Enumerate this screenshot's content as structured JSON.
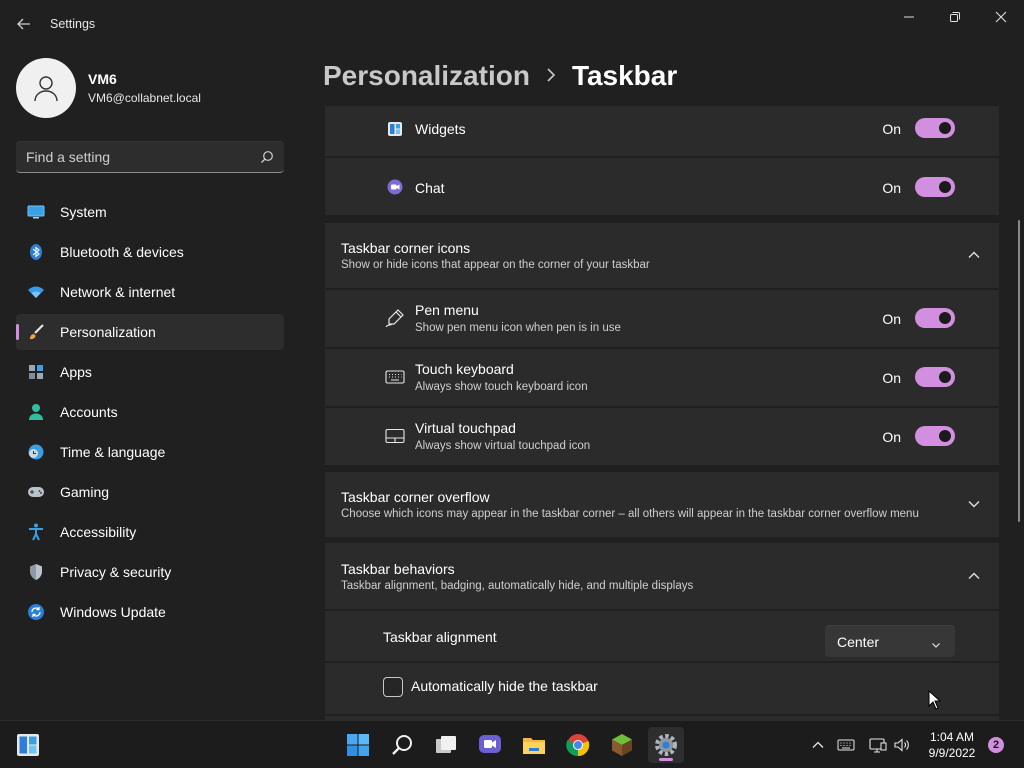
{
  "window": {
    "title": "Settings"
  },
  "user": {
    "name": "VM6",
    "email": "VM6@collabnet.local"
  },
  "search": {
    "placeholder": "Find a setting"
  },
  "nav": {
    "items": [
      {
        "label": "System",
        "icon": "monitor-icon"
      },
      {
        "label": "Bluetooth & devices",
        "icon": "bluetooth-icon"
      },
      {
        "label": "Network & internet",
        "icon": "wifi-icon"
      },
      {
        "label": "Personalization",
        "icon": "brush-icon",
        "active": true
      },
      {
        "label": "Apps",
        "icon": "apps-icon"
      },
      {
        "label": "Accounts",
        "icon": "person-icon"
      },
      {
        "label": "Time & language",
        "icon": "globe-clock-icon"
      },
      {
        "label": "Gaming",
        "icon": "gamepad-icon"
      },
      {
        "label": "Accessibility",
        "icon": "accessibility-icon"
      },
      {
        "label": "Privacy & security",
        "icon": "shield-icon"
      },
      {
        "label": "Windows Update",
        "icon": "update-icon"
      }
    ]
  },
  "breadcrumb": {
    "parent": "Personalization",
    "current": "Taskbar"
  },
  "main": {
    "widgets": {
      "label": "Widgets",
      "state": "On"
    },
    "chat": {
      "label": "Chat",
      "state": "On"
    },
    "corner_icons": {
      "title": "Taskbar corner icons",
      "desc": "Show or hide icons that appear on the corner of your taskbar"
    },
    "pen_menu": {
      "label": "Pen menu",
      "desc": "Show pen menu icon when pen is in use",
      "state": "On"
    },
    "touch_keyboard": {
      "label": "Touch keyboard",
      "desc": "Always show touch keyboard icon",
      "state": "On"
    },
    "virtual_touchpad": {
      "label": "Virtual touchpad",
      "desc": "Always show virtual touchpad icon",
      "state": "On"
    },
    "corner_overflow": {
      "title": "Taskbar corner overflow",
      "desc": "Choose which icons may appear in the taskbar corner – all others will appear in the taskbar corner overflow menu"
    },
    "behaviors": {
      "title": "Taskbar behaviors",
      "desc": "Taskbar alignment, badging, automatically hide, and multiple displays"
    },
    "alignment": {
      "label": "Taskbar alignment",
      "value": "Center"
    },
    "auto_hide": {
      "label": "Automatically hide the taskbar"
    }
  },
  "taskbar": {
    "time": "1:04 AM",
    "date": "9/9/2022",
    "notification_count": "2"
  },
  "colors": {
    "accent": "#d28fe0",
    "background": "#202020",
    "card": "#2b2b2b"
  }
}
